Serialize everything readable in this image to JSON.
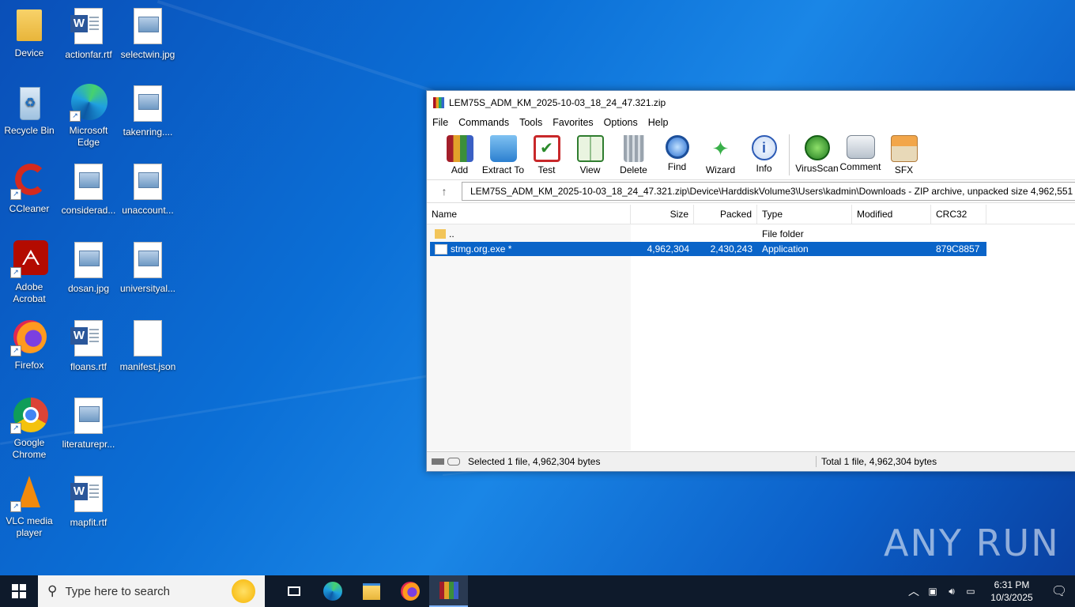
{
  "desktop": {
    "icons": [
      {
        "label": "Device"
      },
      {
        "label": "actionfar.rtf"
      },
      {
        "label": "selectwin.jpg"
      },
      {
        "label": "Recycle Bin"
      },
      {
        "label": "Microsoft Edge"
      },
      {
        "label": "takenring...."
      },
      {
        "label": "CCleaner"
      },
      {
        "label": "considerad..."
      },
      {
        "label": "unaccount..."
      },
      {
        "label": "Adobe Acrobat"
      },
      {
        "label": "dosan.jpg"
      },
      {
        "label": "universityal..."
      },
      {
        "label": "Firefox"
      },
      {
        "label": "floans.rtf"
      },
      {
        "label": "manifest.json"
      },
      {
        "label": "Google Chrome"
      },
      {
        "label": "literaturepr..."
      },
      {
        "label": "VLC media player"
      },
      {
        "label": "mapfit.rtf"
      }
    ]
  },
  "window": {
    "title": "LEM75S_ADM_KM_2025-10-03_18_24_47.321.zip",
    "menu": [
      "File",
      "Commands",
      "Tools",
      "Favorites",
      "Options",
      "Help"
    ],
    "toolbar": [
      "Add",
      "Extract To",
      "Test",
      "View",
      "Delete",
      "Find",
      "Wizard",
      "Info",
      "VirusScan",
      "Comment",
      "SFX"
    ],
    "address": "LEM75S_ADM_KM_2025-10-03_18_24_47.321.zip\\Device\\HarddiskVolume3\\Users\\kadmin\\Downloads - ZIP archive, unpacked size 4,962,551 by",
    "columns": [
      "Name",
      "Size",
      "Packed",
      "Type",
      "Modified",
      "CRC32"
    ],
    "rows": [
      {
        "name": "..",
        "size": "",
        "packed": "",
        "type": "File folder",
        "modified": "",
        "crc": ""
      },
      {
        "name": "stmg.org.exe *",
        "size": "4,962,304",
        "packed": "2,430,243",
        "type": "Application",
        "modified": "",
        "crc": "879C8857"
      }
    ],
    "status_left": "Selected 1 file, 4,962,304 bytes",
    "status_right": "Total 1 file, 4,962,304 bytes"
  },
  "taskbar": {
    "search_placeholder": "Type here to search",
    "time": "6:31 PM",
    "date": "10/3/2025"
  },
  "watermark": "ANY RUN"
}
